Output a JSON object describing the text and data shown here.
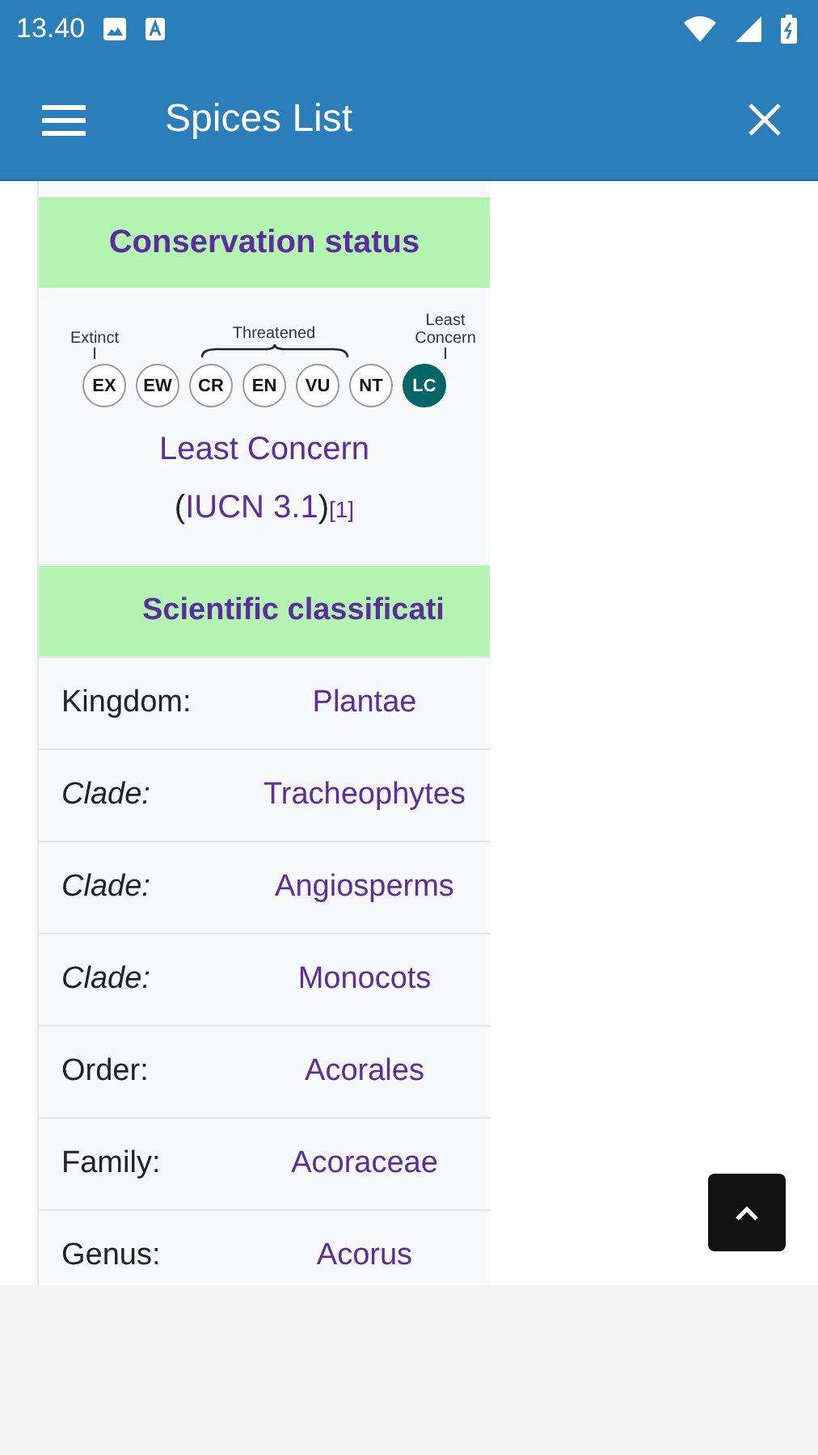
{
  "status_bar": {
    "time": "13.40"
  },
  "app_bar": {
    "title": "Spices List"
  },
  "conservation": {
    "title": "Conservation status",
    "groups": [
      {
        "label": "Extinct",
        "kind": "tick"
      },
      {
        "label": "Threatened",
        "kind": "brace"
      },
      {
        "label": "Least Concern",
        "kind": "tick"
      }
    ],
    "scale": [
      {
        "code": "EX",
        "selected": false
      },
      {
        "code": "EW",
        "selected": false
      },
      {
        "code": "CR",
        "selected": false
      },
      {
        "code": "EN",
        "selected": false
      },
      {
        "code": "VU",
        "selected": false
      },
      {
        "code": "NT",
        "selected": false
      },
      {
        "code": "LC",
        "selected": true
      }
    ],
    "status_text": [
      {
        "text": "Least Concern",
        "kind": "link"
      },
      {
        "text": " (",
        "kind": "plain"
      },
      {
        "text": "IUCN 3.1",
        "kind": "link"
      },
      {
        "text": ")",
        "kind": "plain"
      },
      {
        "text": "[1]",
        "kind": "ref"
      }
    ]
  },
  "classification": {
    "title": "Scientific classificati",
    "rows": [
      {
        "label": "Kingdom:",
        "italic": false,
        "value": "Plantae"
      },
      {
        "label": "Clade:",
        "italic": true,
        "value": "Tracheophytes"
      },
      {
        "label": "Clade:",
        "italic": true,
        "value": "Angiosperms"
      },
      {
        "label": "Clade:",
        "italic": true,
        "value": "Monocots"
      },
      {
        "label": "Order:",
        "italic": false,
        "value": "Acorales"
      },
      {
        "label": "Family:",
        "italic": false,
        "value": "Acoraceae"
      },
      {
        "label": "Genus:",
        "italic": false,
        "value": "Acorus"
      }
    ]
  }
}
